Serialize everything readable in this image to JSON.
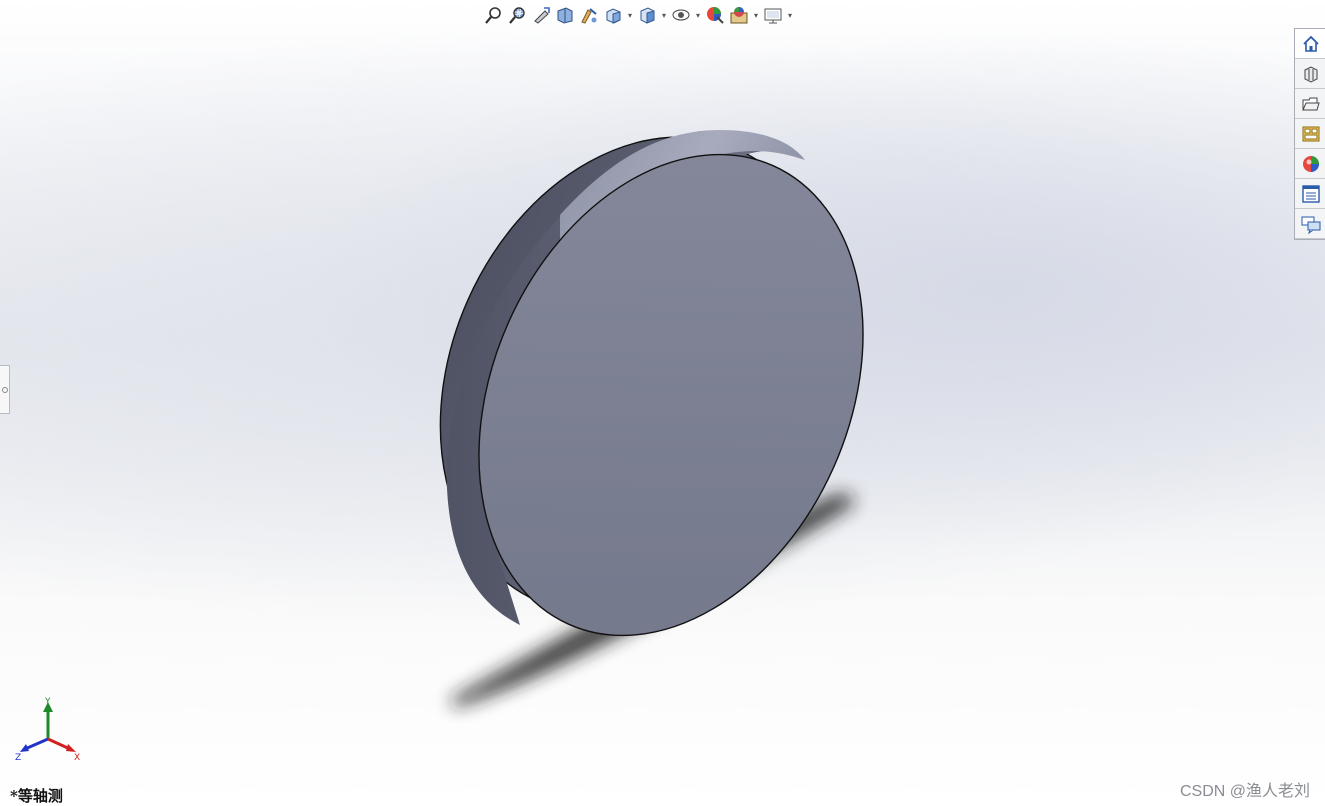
{
  "view": {
    "orientation_label": "*等轴测",
    "background_gradient": [
      "#ffffff",
      "#e7e9ef",
      "#ffffff"
    ]
  },
  "heads_up_toolbar": {
    "buttons": [
      {
        "icon": "zoom-to-fit-icon",
        "has_dropdown": false
      },
      {
        "icon": "zoom-to-area-icon",
        "has_dropdown": false
      },
      {
        "icon": "previous-view-icon",
        "has_dropdown": false
      },
      {
        "icon": "section-view-icon",
        "has_dropdown": false
      },
      {
        "icon": "dynamic-annotation-views-icon",
        "has_dropdown": false
      },
      {
        "icon": "view-orientation-icon",
        "has_dropdown": true
      },
      {
        "icon": "display-style-icon",
        "has_dropdown": true
      },
      {
        "icon": "hide-show-items-icon",
        "has_dropdown": true
      },
      {
        "icon": "edit-appearance-icon",
        "has_dropdown": false
      },
      {
        "icon": "apply-scene-icon",
        "has_dropdown": true
      },
      {
        "icon": "view-settings-icon",
        "has_dropdown": true
      }
    ]
  },
  "task_pane": {
    "tabs": [
      {
        "icon": "home-icon"
      },
      {
        "icon": "design-library-icon"
      },
      {
        "icon": "file-explorer-icon"
      },
      {
        "icon": "view-palette-icon"
      },
      {
        "icon": "appearances-scenes-icon"
      },
      {
        "icon": "custom-properties-icon"
      },
      {
        "icon": "forum-icon"
      }
    ]
  },
  "triad": {
    "axes": [
      "Y",
      "Z",
      "X"
    ],
    "colors": {
      "x": "#d02020",
      "y": "#1e8a2a",
      "z": "#2233cc"
    }
  },
  "model": {
    "type": "cylinder-disc",
    "face_color": "#7e8294",
    "side_color": "#5c6072"
  },
  "watermark": "CSDN @渔人老刘"
}
